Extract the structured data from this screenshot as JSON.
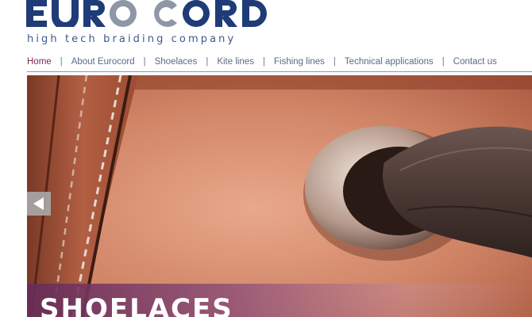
{
  "logo": {
    "wordmark": "EUROCORD",
    "tagline": "high tech braiding company",
    "colors": {
      "navy": "#1f3b78",
      "grey": "#8d97a6"
    }
  },
  "nav": {
    "items": [
      {
        "label": "Home",
        "active": true
      },
      {
        "label": "About Eurocord",
        "active": false
      },
      {
        "label": "Shoelaces",
        "active": false
      },
      {
        "label": "Kite lines",
        "active": false
      },
      {
        "label": "Fishing lines",
        "active": false
      },
      {
        "label": "Technical applications",
        "active": false
      },
      {
        "label": "Contact us",
        "active": false
      }
    ],
    "separator": "|",
    "active_color": "#7d2a5c",
    "text_color": "#5b6a87"
  },
  "hero": {
    "image": "leather-shoe-eyelet-photo",
    "prev_icon": "left-arrow-icon",
    "caption": "SHOELACES",
    "caption_color": "#6b2c5a"
  }
}
